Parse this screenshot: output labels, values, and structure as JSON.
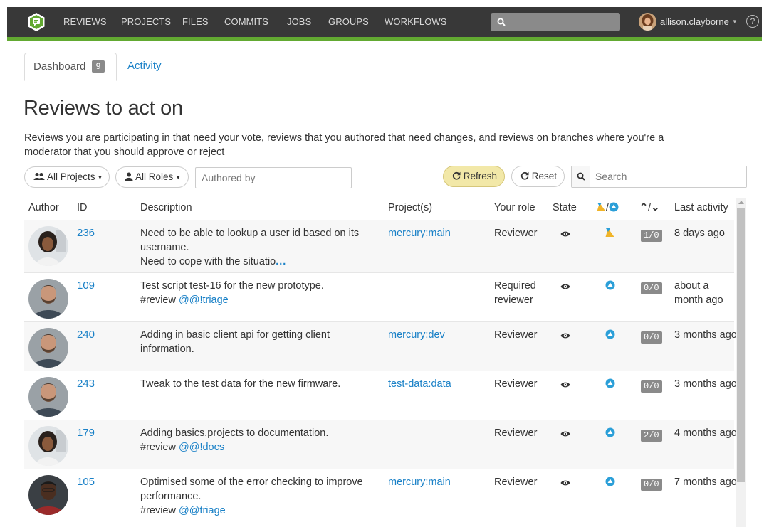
{
  "nav": {
    "items": [
      "REVIEWS",
      "PROJECTS",
      "FILES",
      "COMMITS",
      "JOBS",
      "GROUPS",
      "WORKFLOWS"
    ],
    "username": "allison.clayborne",
    "help": "?",
    "colors": {
      "bar": "#383838",
      "accent": "#62a931"
    }
  },
  "tabs": {
    "dashboard_label": "Dashboard",
    "dashboard_count": "9",
    "activity_label": "Activity"
  },
  "page": {
    "title": "Reviews to act on",
    "description": "Reviews you are participating in that need your vote, reviews that you authored that need changes, and reviews on branches where you're a moderator that you should approve or reject"
  },
  "filters": {
    "projects_label": "All Projects",
    "roles_label": "All Roles",
    "authored_placeholder": "Authored by",
    "refresh_label": "Refresh",
    "reset_label": "Reset",
    "search_placeholder": "Search"
  },
  "table": {
    "columns": {
      "author": "Author",
      "id": "ID",
      "description": "Description",
      "projects": "Project(s)",
      "role": "Your role",
      "state": "State",
      "votes": "/",
      "updown": "/",
      "last": "Last activity"
    },
    "rows": [
      {
        "author_avatar": "woman-avatar",
        "id": "236",
        "desc_line1": "Need to be able to lookup a user id based on its username.",
        "desc_line2": "Need to cope with the situatio",
        "desc_more": "...",
        "project": "mercury:main",
        "role": "Reviewer",
        "state_icon": "eye-icon",
        "vote_icon": "needs-review-icon",
        "count": "1/0",
        "last": "8 days ago"
      },
      {
        "author_avatar": "bearded-man-avatar",
        "id": "109",
        "desc_line1": "Test script test-16 for the new prototype.",
        "desc_tag_prefix": "#review ",
        "desc_tag": "@@!triage",
        "project": "",
        "role": "Required reviewer",
        "state_icon": "eye-icon",
        "vote_icon": "up-vote-icon",
        "count": "0/0",
        "last": "about a month ago"
      },
      {
        "author_avatar": "bearded-man-avatar",
        "id": "240",
        "desc_line1": "Adding in basic client api for getting client information.",
        "project": "mercury:dev",
        "role": "Reviewer",
        "state_icon": "eye-icon",
        "vote_icon": "up-vote-icon",
        "count": "0/0",
        "last": "3 months ago"
      },
      {
        "author_avatar": "bearded-man-avatar",
        "id": "243",
        "desc_line1": "Tweak to the test data for the new firmware.",
        "project": "test-data:data",
        "role": "Reviewer",
        "state_icon": "eye-icon",
        "vote_icon": "up-vote-icon",
        "count": "0/0",
        "last": "3 months ago"
      },
      {
        "author_avatar": "woman-avatar",
        "id": "179",
        "desc_line1": "Adding basics.projects to documentation.",
        "desc_tag_prefix": "#review ",
        "desc_tag": "@@!docs",
        "project": "",
        "role": "Reviewer",
        "state_icon": "eye-icon",
        "vote_icon": "up-vote-icon",
        "count": "2/0",
        "last": "4 months ago"
      },
      {
        "author_avatar": "man-avatar",
        "id": "105",
        "desc_line1": "Optimised some of the error checking to improve performance.",
        "desc_tag_prefix": "#review ",
        "desc_tag": "@@triage",
        "project": "mercury:main",
        "role": "Reviewer",
        "state_icon": "eye-icon",
        "vote_icon": "up-vote-icon",
        "count": "0/0",
        "last": "7 months ago"
      }
    ]
  }
}
